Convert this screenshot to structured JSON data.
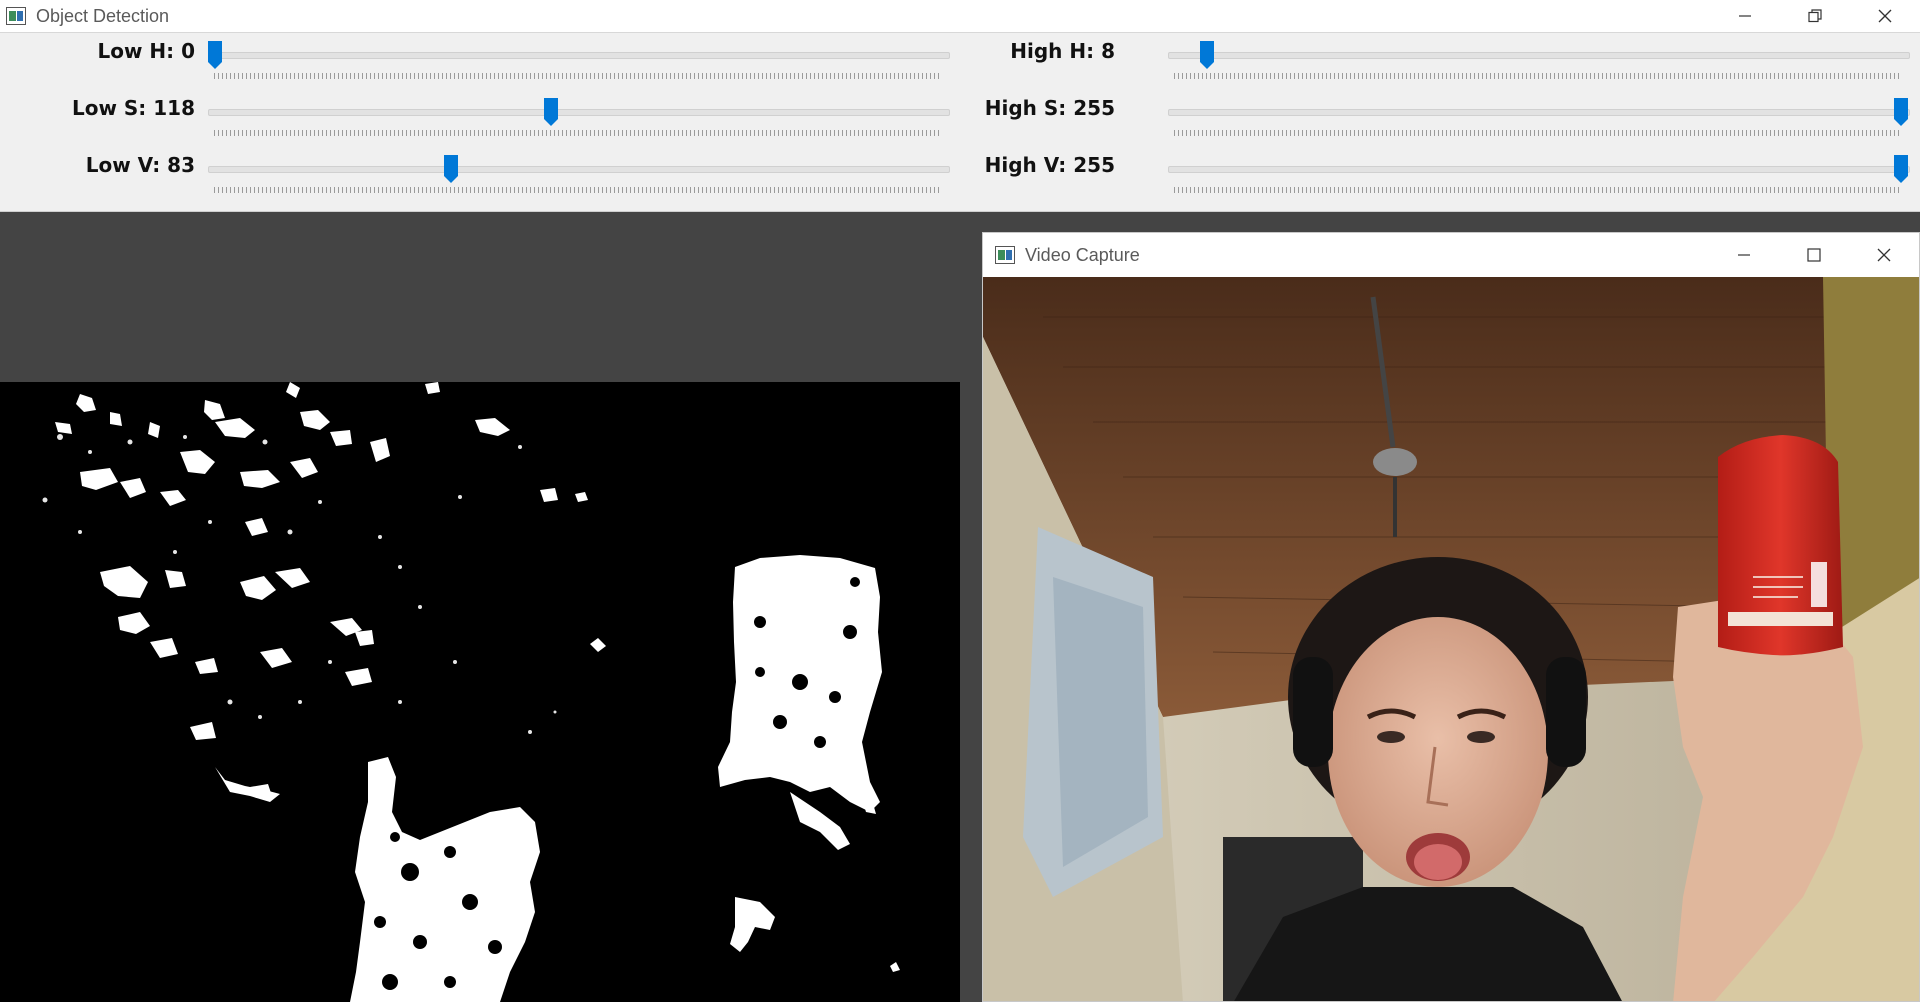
{
  "object_detection": {
    "title": "Object Detection",
    "trackbars": [
      {
        "label": "Low H: 0",
        "value": 0,
        "max": 180
      },
      {
        "label": "High H: 8",
        "value": 8,
        "max": 180
      },
      {
        "label": "Low S: 118",
        "value": 118,
        "max": 255
      },
      {
        "label": "High S: 255",
        "value": 255,
        "max": 255
      },
      {
        "label": "Low V: 83",
        "value": 83,
        "max": 255
      },
      {
        "label": "High V: 255",
        "value": 255,
        "max": 255
      }
    ]
  },
  "video_capture": {
    "title": "Video Capture"
  },
  "colors": {
    "thumb": "#0078d7",
    "mask_foreground": "#ffffff",
    "mask_background": "#000000",
    "desktop": "#444444"
  },
  "icons": [
    "app-icon",
    "minimize-icon",
    "restore-icon",
    "maximize-icon",
    "close-icon"
  ]
}
